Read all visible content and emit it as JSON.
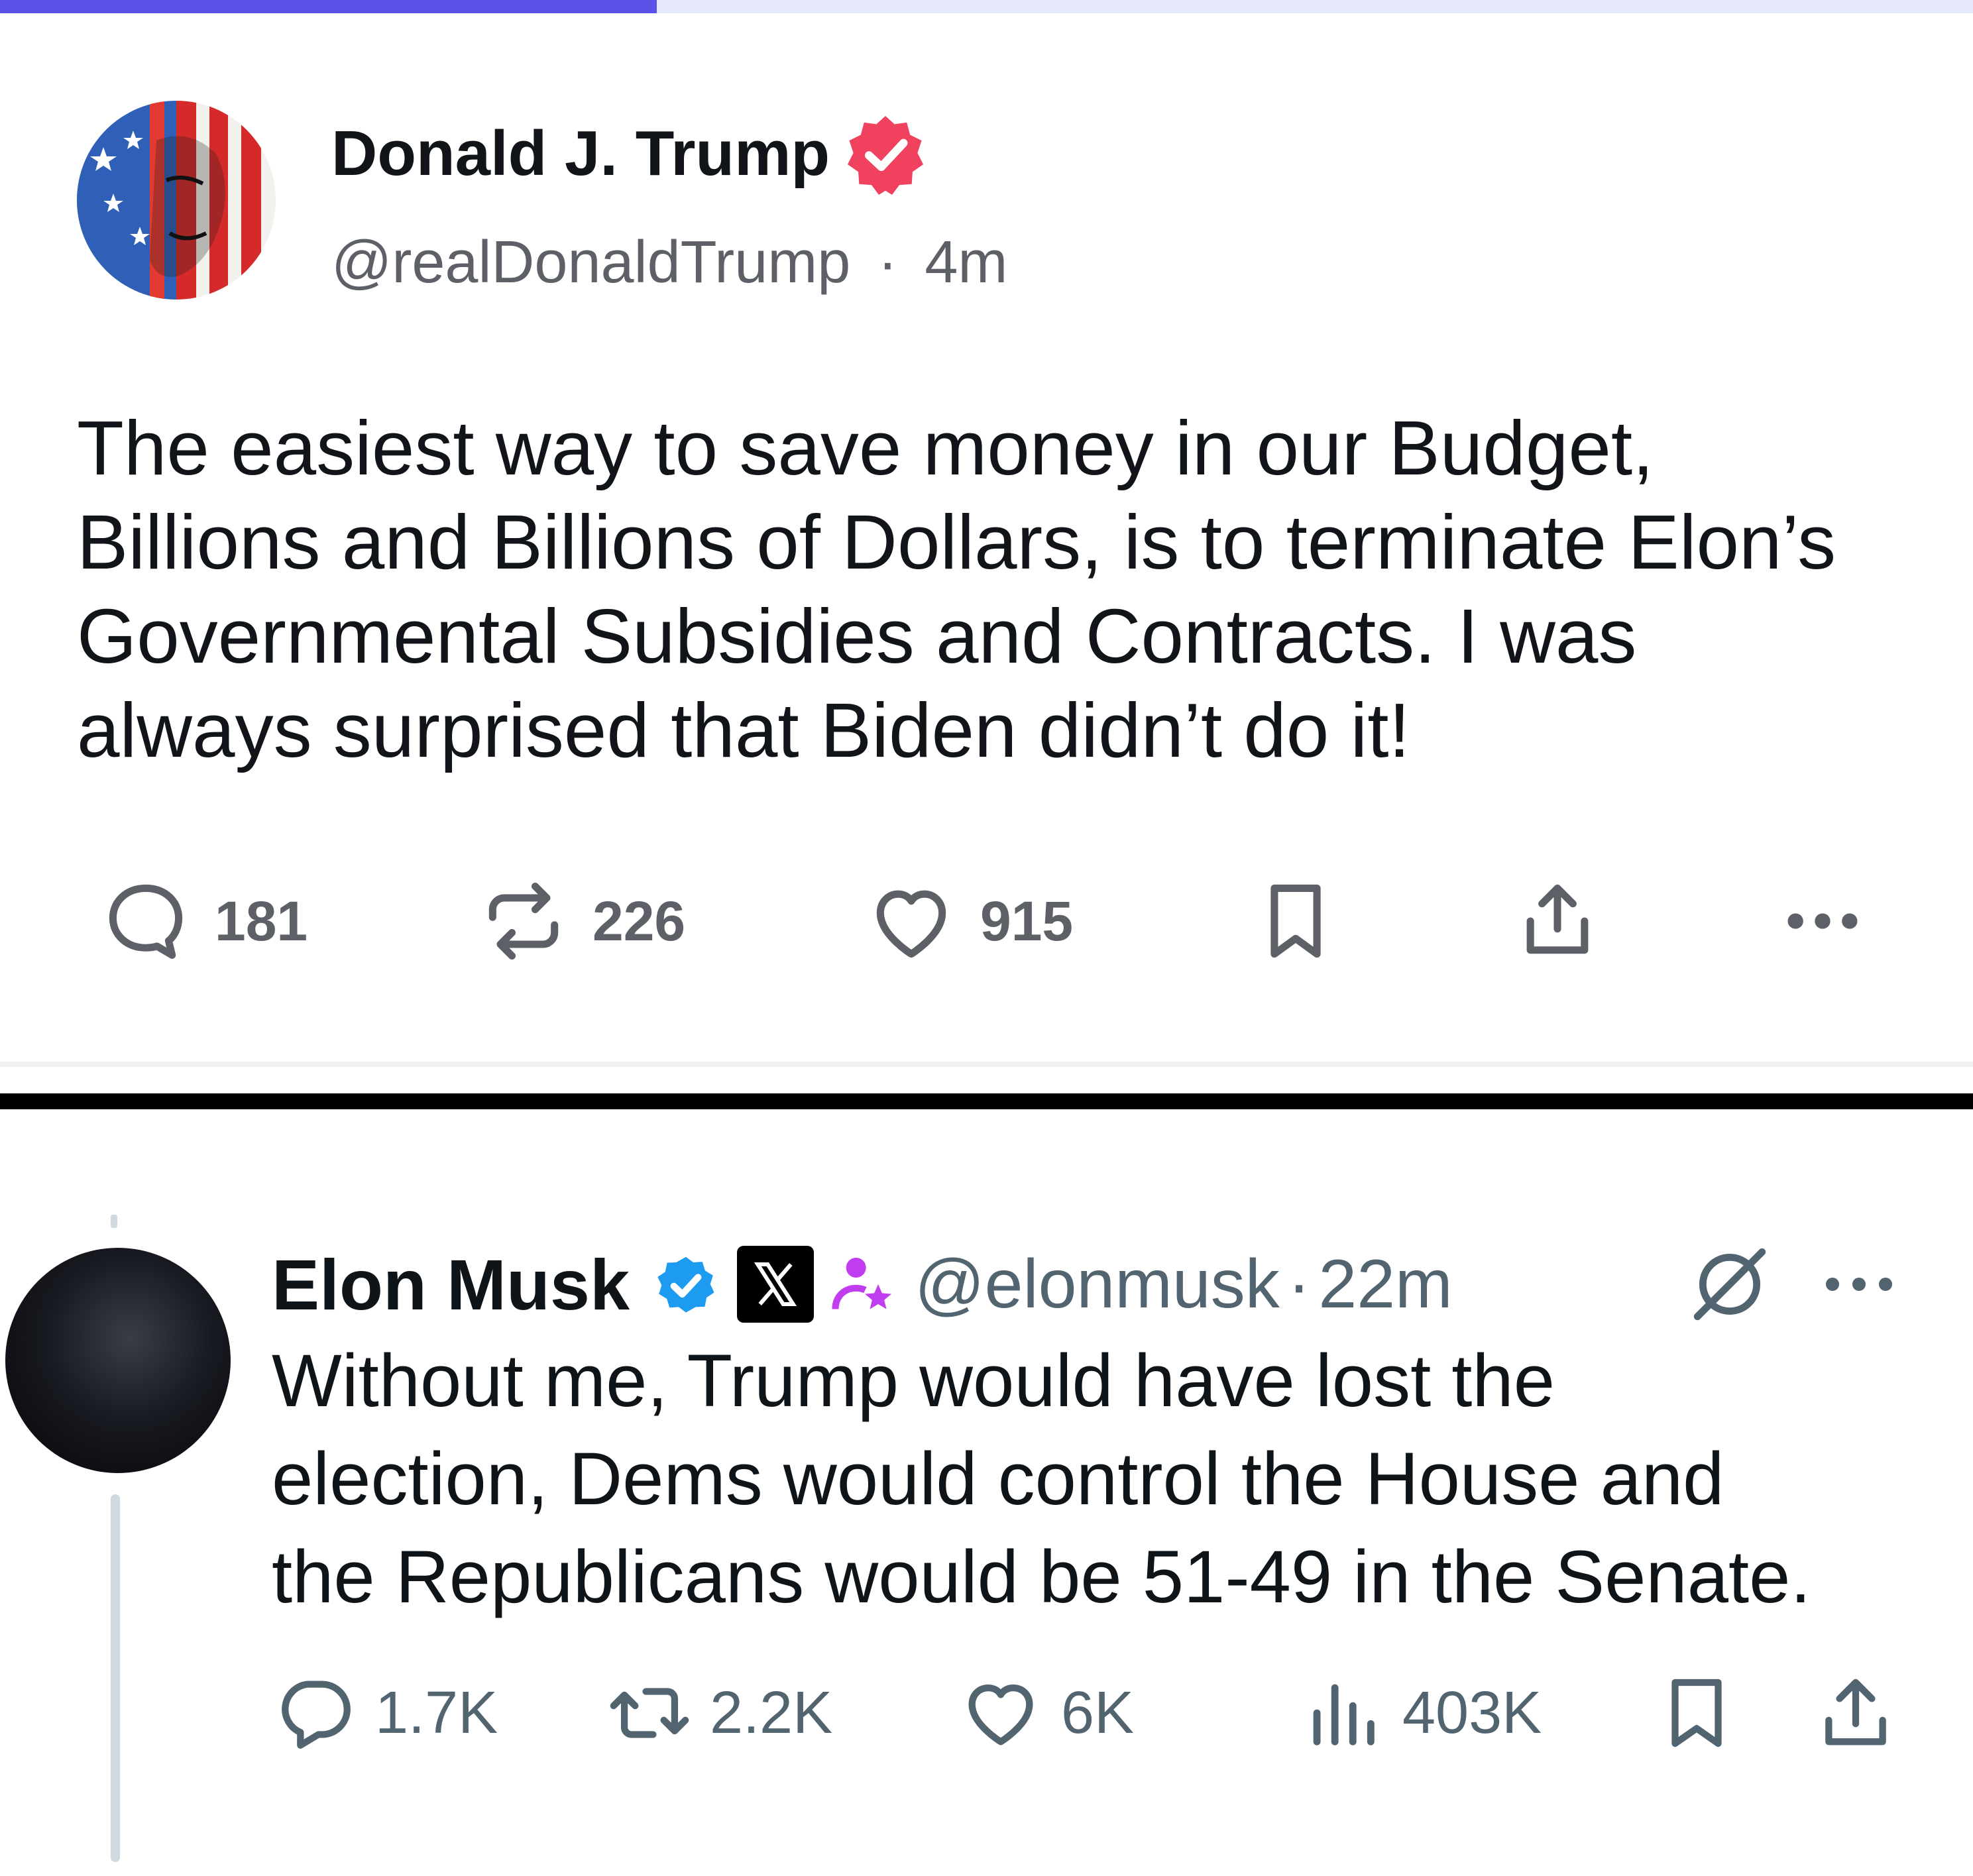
{
  "colors": {
    "progress_fill": "#5b52e8",
    "progress_track": "#e6e8fb",
    "truth_badge": "#f0415e",
    "x_verified": "#1d9bf0",
    "affiliate_badge": "#c13ef0"
  },
  "progress": {
    "fraction": 0.333
  },
  "post1": {
    "name": "Donald J. Trump",
    "handle": "@realDonaldTrump",
    "separator": "·",
    "time": "4m",
    "body_lines": [
      "The easiest way to save money in our Budget,",
      "Billions and Billions of Dollars, is to terminate Elon’s",
      "Governmental Subsidies and Contracts. I was",
      "always surprised that Biden didn’t do it!"
    ],
    "actions": {
      "replies": "181",
      "retruths": "226",
      "likes": "915"
    },
    "icons": [
      "avatar",
      "verified-badge-icon",
      "reply-icon",
      "retruth-icon",
      "like-icon",
      "bookmark-icon",
      "share-icon",
      "more-icon"
    ]
  },
  "post2": {
    "name": "Elon Musk",
    "handle": "@elonmusk",
    "separator": "·",
    "time": "22m",
    "body_lines": [
      "Without me, Trump would have lost the",
      "election, Dems would control the House and",
      "the Republicans would be 51-49 in the Senate."
    ],
    "actions": {
      "replies": "1.7K",
      "reposts": "2.2K",
      "likes": "6K",
      "views": "403K"
    },
    "icons": [
      "avatar",
      "verified-badge-icon",
      "x-logo-icon",
      "affiliate-badge-icon",
      "grok-icon",
      "more-icon",
      "reply-icon",
      "repost-icon",
      "like-icon",
      "views-icon",
      "bookmark-icon",
      "share-icon"
    ]
  }
}
